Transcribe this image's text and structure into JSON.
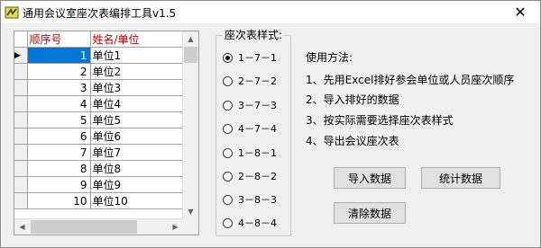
{
  "window": {
    "title": "通用会议室座次表编排工具v1.5",
    "close_glyph": "✕",
    "icon": "app-icon"
  },
  "grid": {
    "headers": {
      "seq": "顺序号",
      "name": "姓名/单位"
    },
    "rows": [
      {
        "seq": "1",
        "name": "单位1"
      },
      {
        "seq": "2",
        "name": "单位2"
      },
      {
        "seq": "3",
        "name": "单位3"
      },
      {
        "seq": "4",
        "name": "单位4"
      },
      {
        "seq": "5",
        "name": "单位5"
      },
      {
        "seq": "6",
        "name": "单位6"
      },
      {
        "seq": "7",
        "name": "单位7"
      },
      {
        "seq": "8",
        "name": "单位8"
      },
      {
        "seq": "9",
        "name": "单位9"
      },
      {
        "seq": "10",
        "name": "单位10"
      }
    ],
    "current_row_marker": "▶"
  },
  "style_group": {
    "legend": "座次表样式:",
    "options": [
      {
        "label": "1－7－1",
        "checked": true
      },
      {
        "label": "2－7－2",
        "checked": false
      },
      {
        "label": "3－7－3",
        "checked": false
      },
      {
        "label": "4－7－4",
        "checked": false
      },
      {
        "label": "1－8－1",
        "checked": false
      },
      {
        "label": "2－8－2",
        "checked": false
      },
      {
        "label": "3－8－3",
        "checked": false
      },
      {
        "label": "4－8－4",
        "checked": false
      }
    ]
  },
  "instructions": {
    "title": "使用方法:",
    "steps": [
      "1、先用Excel排好参会单位或人员座次顺序",
      "2、导入排好的数据",
      "3、按实际需要选择座次表样式",
      "4、导出会议座次表"
    ]
  },
  "buttons": {
    "import": "导入数据",
    "stats": "统计数据",
    "clear": "清除数据"
  }
}
